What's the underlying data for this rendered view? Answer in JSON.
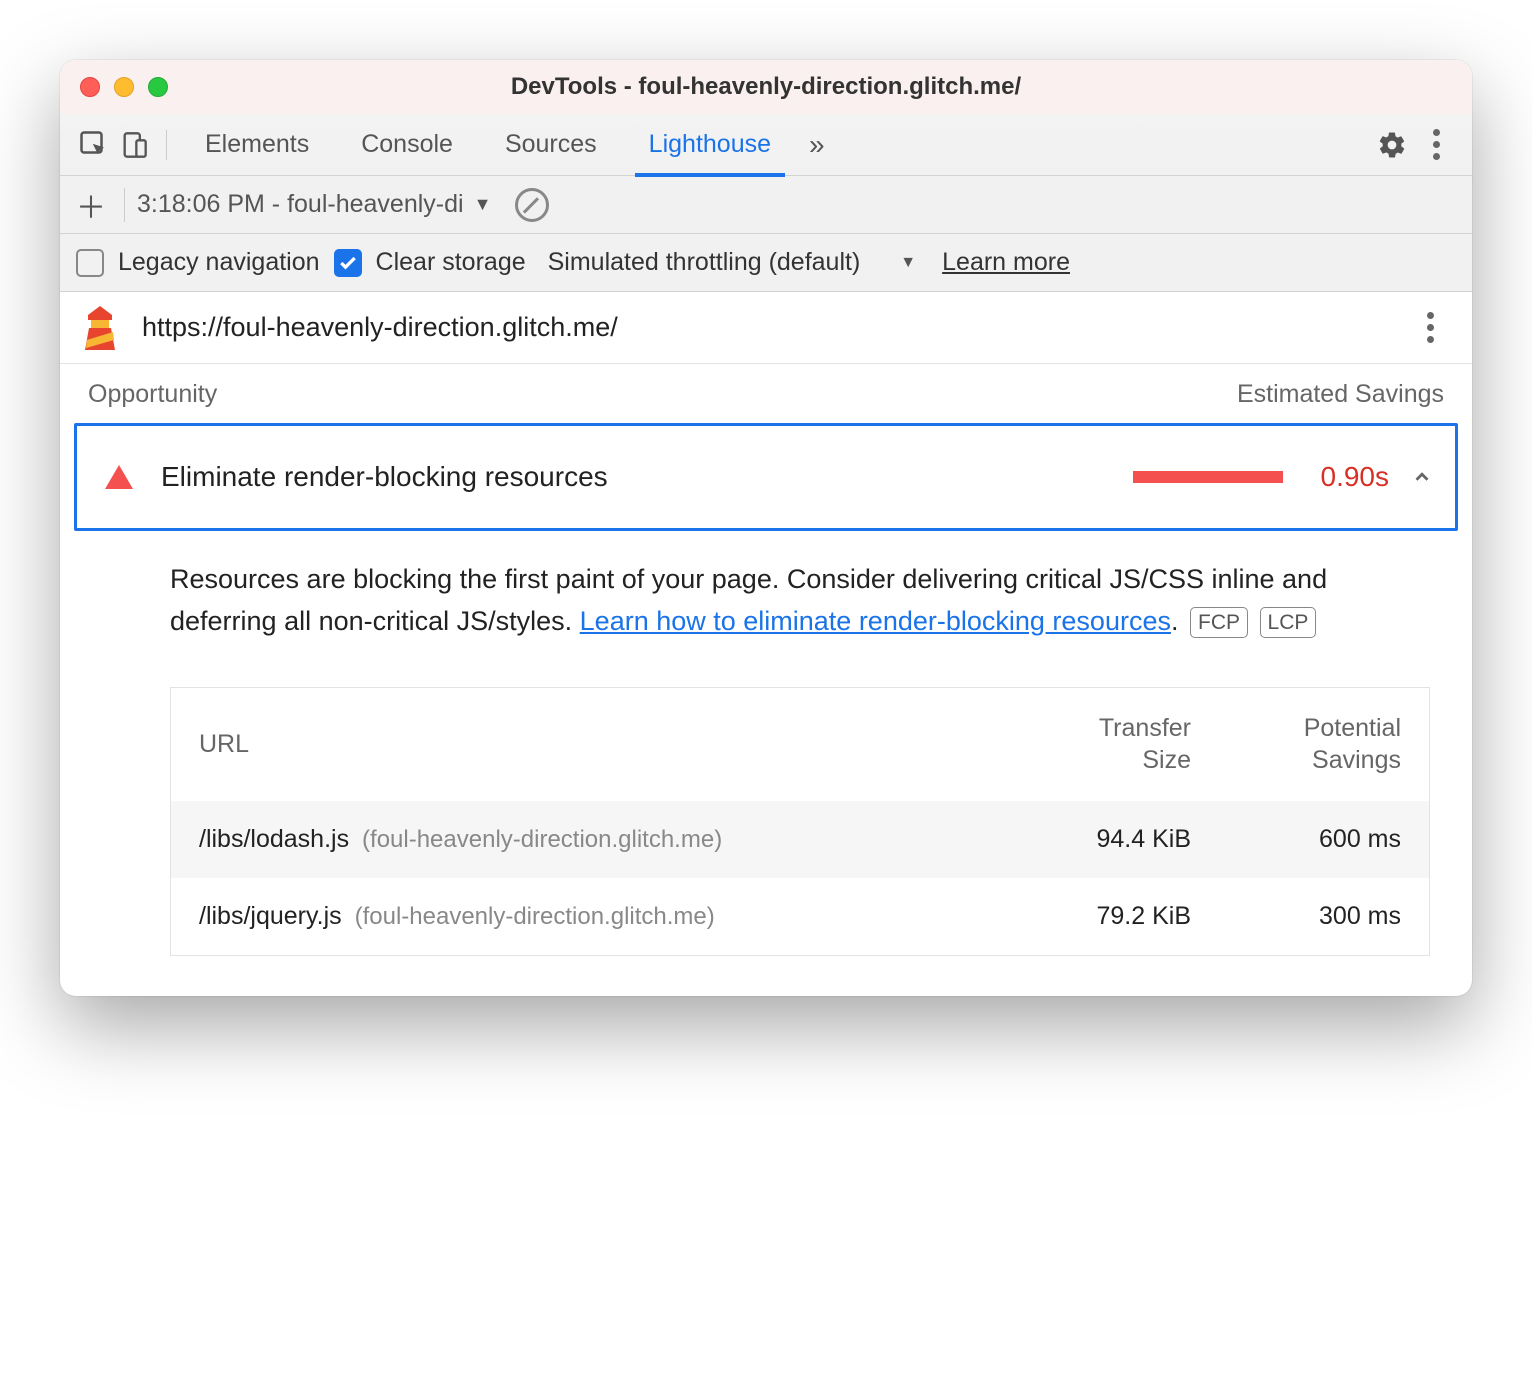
{
  "window": {
    "title": "DevTools - foul-heavenly-direction.glitch.me/"
  },
  "tabs": {
    "items": [
      "Elements",
      "Console",
      "Sources",
      "Lighthouse"
    ],
    "active_index": 3
  },
  "report_bar": {
    "selected": "3:18:06 PM - foul-heavenly-di"
  },
  "options": {
    "legacy_label": "Legacy navigation",
    "legacy_checked": false,
    "clear_label": "Clear storage",
    "clear_checked": true,
    "throttling_label": "Simulated throttling (default)",
    "learn_more": "Learn more"
  },
  "url_row": {
    "url": "https://foul-heavenly-direction.glitch.me/"
  },
  "section": {
    "left": "Opportunity",
    "right": "Estimated Savings"
  },
  "opportunity": {
    "title": "Eliminate render-blocking resources",
    "savings": "0.90s"
  },
  "description": {
    "text1": "Resources are blocking the first paint of your page. Consider delivering critical JS/CSS inline and deferring all non-critical JS/styles. ",
    "link": "Learn how to eliminate render-blocking resources",
    "text2": ".",
    "badges": [
      "FCP",
      "LCP"
    ]
  },
  "table": {
    "headers": {
      "url": "URL",
      "size": "Transfer Size",
      "savings": "Potential Savings"
    },
    "rows": [
      {
        "path": "/libs/lodash.js",
        "host": "(foul-heavenly-direction.glitch.me)",
        "size": "94.4 KiB",
        "savings": "600 ms"
      },
      {
        "path": "/libs/jquery.js",
        "host": "(foul-heavenly-direction.glitch.me)",
        "size": "79.2 KiB",
        "savings": "300 ms"
      }
    ]
  }
}
